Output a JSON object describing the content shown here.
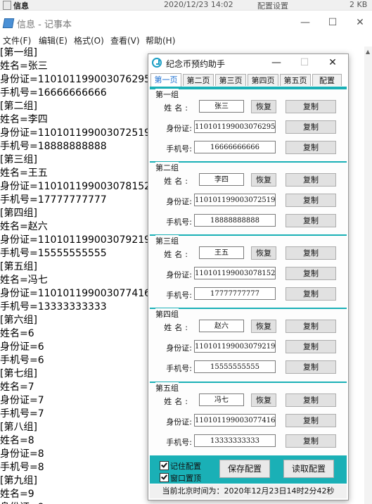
{
  "file_row": {
    "name": "信息",
    "date": "2020/12/23 14:02",
    "type": "配置设置",
    "size": "2 KB"
  },
  "notepad": {
    "title": "信息 - 记事本",
    "window_buttons": {
      "minimize": "—",
      "maximize": "☐",
      "close": "✕"
    },
    "menu": [
      "文件(F)",
      "编辑(E)",
      "格式(O)",
      "查看(V)",
      "帮助(H)"
    ],
    "lines": [
      "[第一组]",
      "姓名=张三",
      "身份证=110101199003076295",
      "手机号=16666666666",
      "[第二组]",
      "姓名=李四",
      "身份证=110101199003072519",
      "手机号=18888888888",
      "[第三组]",
      "姓名=王五",
      "身份证=110101199003078152",
      "手机号=17777777777",
      "[第四组]",
      "姓名=赵六",
      "身份证=110101199003079219",
      "手机号=15555555555",
      "[第五组]",
      "姓名=冯七",
      "身份证=110101199003077416",
      "手机号=13333333333",
      "[第六组]",
      "姓名=6",
      "身份证=6",
      "手机号=6",
      "[第七组]",
      "姓名=7",
      "身份证=7",
      "手机号=7",
      "[第八组]",
      "姓名=8",
      "身份证=8",
      "手机号=8",
      "[第九组]",
      "姓名=9",
      "身份证=9"
    ]
  },
  "app": {
    "title": "纪念币预约助手",
    "window_buttons": {
      "minimize": "—",
      "maximize": "☐",
      "close": "✕"
    },
    "tabs": [
      "第一页",
      "第二页",
      "第三页",
      "第四页",
      "第五页",
      "配置"
    ],
    "active_tab": 0,
    "labels": {
      "name": "姓名:",
      "id_card": "身份证:",
      "phone": "手机号:",
      "restore": "恢复",
      "copy": "复制"
    },
    "groups": [
      {
        "label": "第一组",
        "name": "张三",
        "id_card": "110101199003076295",
        "phone": "16666666666"
      },
      {
        "label": "第二组",
        "name": "李四",
        "id_card": "110101199003072519",
        "phone": "18888888888"
      },
      {
        "label": "第三组",
        "name": "王五",
        "id_card": "110101199003078152",
        "phone": "17777777777"
      },
      {
        "label": "第四组",
        "name": "赵六",
        "id_card": "110101199003079219",
        "phone": "15555555555"
      },
      {
        "label": "第五组",
        "name": "冯七",
        "id_card": "110101199003077416",
        "phone": "13333333333"
      }
    ],
    "checkboxes": [
      {
        "label": "记住配置",
        "checked": true
      },
      {
        "label": "窗口置顶",
        "checked": true
      }
    ],
    "save_button": "保存配置",
    "load_button": "读取配置",
    "status": "当前北京时间为：2020年12月23日14时2分42秒"
  },
  "colors": {
    "accent": "#1ab0b6",
    "active_tab_text": "#1b6fd1"
  }
}
